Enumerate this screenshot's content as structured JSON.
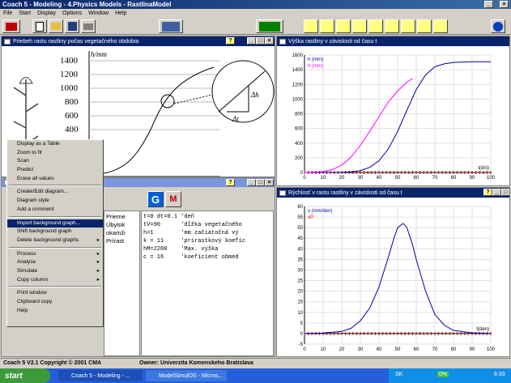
{
  "app": {
    "title": "Coach 5 - Modeling - 4.Physics Models - RastlinaModel",
    "menu": [
      "File",
      "Start",
      "Display",
      "Options",
      "Window",
      "Help"
    ]
  },
  "panels": {
    "left_top_title": "Priebeh rastu rastliny počas vegetačného obdobia",
    "right_top_title": "Výška rastliny v závislosti od času t",
    "right_bottom_title": "Rýchlosť v rastu rastliny v závislosti od času t"
  },
  "background_image": {
    "y_unit": "h/mm",
    "y_ticks": [
      "1400",
      "1200",
      "1000",
      "800",
      "600",
      "400"
    ],
    "delta_h": "Δh",
    "delta_t": "Δt"
  },
  "context_menu": {
    "items": [
      {
        "label": "Display as a Table"
      },
      {
        "label": "Zoom to fit"
      },
      {
        "label": "Scan"
      },
      {
        "label": "Predict"
      },
      {
        "label": "Erase all values"
      },
      {
        "sep": true
      },
      {
        "label": "Create/Edit diagram..."
      },
      {
        "label": "Diagram style"
      },
      {
        "label": "Add a comment"
      },
      {
        "sep": true
      },
      {
        "label": "Import background graph...",
        "highlight": true
      },
      {
        "label": "Shift background graph"
      },
      {
        "label": "Delete background graphs",
        "arrow": true
      },
      {
        "sep": true
      },
      {
        "label": "Process",
        "arrow": true
      },
      {
        "label": "Analyse",
        "arrow": true
      },
      {
        "label": "Simulate",
        "arrow": true
      },
      {
        "label": "Copy column",
        "arrow": true
      },
      {
        "sep": true
      },
      {
        "label": "Print window"
      },
      {
        "label": "Clipboard copy"
      },
      {
        "label": "Help"
      }
    ]
  },
  "model": {
    "g_label": "G",
    "m_label": "M",
    "desc_lines": [
      "Prieme",
      "Úbytok",
      "okamži",
      "Prírast"
    ],
    "code_lines": [
      "t=0 dt=0.1 'deň",
      "tV=90      'dĺžka vegetačného",
      "h=1        'mm začiatočná vý",
      "k = 11     'prírastkový koefic",
      "hM=2200    'Max. výška",
      "c = 16     'koeficient obmed"
    ]
  },
  "status": {
    "left": "Coach 5 V2.1 Copyright © 2001 CMA",
    "right": "Owner: Univerzita Komenskeho Bratislava"
  },
  "taskbar": {
    "start": "start",
    "tasks": [
      "Coach 5 - Modeling - ...",
      "ModelSimulOS - Micros..."
    ],
    "tray": [
      "SK",
      "0%",
      "6:33"
    ]
  },
  "chart_data": [
    {
      "type": "line",
      "legend": [
        "h (mm)",
        "h (mm)"
      ],
      "legend_placement": "top-left",
      "xlabel": "t(dni)",
      "xlim": [
        0,
        100
      ],
      "ylim": [
        0,
        1600
      ],
      "xticks": [
        0,
        10,
        20,
        30,
        40,
        50,
        60,
        70,
        80,
        90,
        100
      ],
      "yticks": [
        0,
        200,
        400,
        600,
        800,
        1000,
        1200,
        1400,
        1600
      ],
      "grid": true,
      "colors": [
        "#0000a0",
        "#ff00ff"
      ],
      "series": [
        {
          "name": "h (mm)",
          "x": [
            0,
            10,
            20,
            25,
            30,
            35,
            40,
            45,
            50,
            55,
            60,
            65,
            70,
            75,
            80,
            85,
            90,
            100
          ],
          "y": [
            0,
            0,
            2,
            8,
            25,
            70,
            160,
            320,
            560,
            850,
            1130,
            1330,
            1440,
            1480,
            1500,
            1505,
            1510,
            1510
          ]
        },
        {
          "name": "h (mm)",
          "x": [
            0,
            10,
            15,
            20,
            25,
            30,
            35,
            40,
            45,
            50,
            55,
            58
          ],
          "y": [
            0,
            10,
            40,
            100,
            210,
            370,
            560,
            760,
            960,
            1110,
            1230,
            1280
          ]
        }
      ]
    },
    {
      "type": "line",
      "legend": [
        "v (mm/den)",
        "vP"
      ],
      "legend_placement": "top-left",
      "xlabel": "t(den)",
      "xlim": [
        0,
        100
      ],
      "ylim": [
        -5,
        60
      ],
      "xticks": [
        0,
        10,
        20,
        30,
        40,
        50,
        60,
        70,
        80,
        90,
        100
      ],
      "yticks": [
        -5,
        0,
        5,
        10,
        15,
        20,
        25,
        30,
        35,
        40,
        45,
        50,
        55,
        60
      ],
      "grid": true,
      "colors": [
        "#0000a0",
        "#ff0000"
      ],
      "series": [
        {
          "name": "v (mm/den)",
          "x": [
            0,
            10,
            20,
            25,
            30,
            35,
            40,
            45,
            48,
            50,
            53,
            55,
            58,
            60,
            65,
            70,
            75,
            80,
            90,
            100
          ],
          "y": [
            0,
            0.2,
            1,
            2.5,
            6,
            12,
            22,
            36,
            45,
            50,
            52,
            50,
            42,
            35,
            20,
            9,
            4,
            1.5,
            0.3,
            0
          ]
        }
      ]
    }
  ]
}
